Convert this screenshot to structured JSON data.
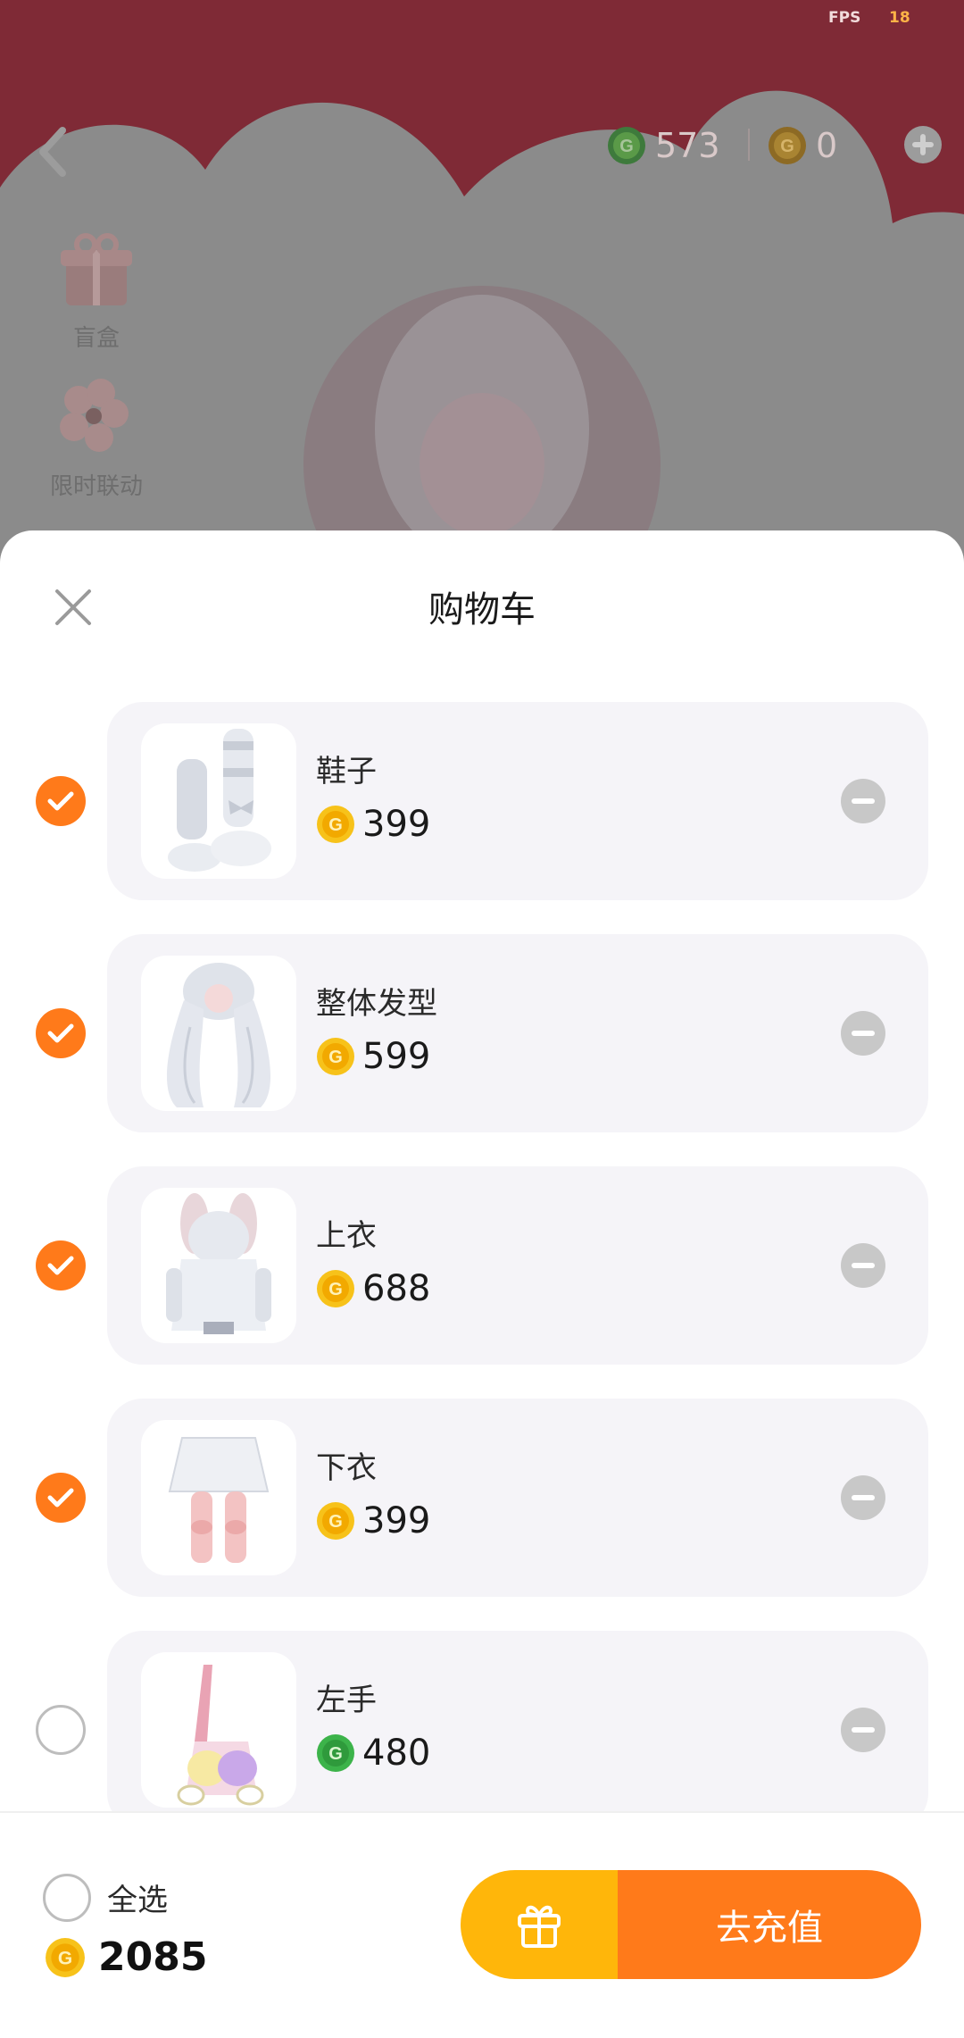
{
  "status": {
    "fps_label": "FPS",
    "fps_value": "18"
  },
  "topbar": {
    "green_coin_balance": "573",
    "gold_coin_balance": "0"
  },
  "side": {
    "gift_label": "盲盒",
    "event_label": "限时联动"
  },
  "cart": {
    "title": "购物车",
    "items": [
      {
        "name": "鞋子",
        "price": "399",
        "currency": "gold",
        "selected": true
      },
      {
        "name": "整体发型",
        "price": "599",
        "currency": "gold",
        "selected": true
      },
      {
        "name": "上衣",
        "price": "688",
        "currency": "gold",
        "selected": true
      },
      {
        "name": "下衣",
        "price": "399",
        "currency": "gold",
        "selected": true
      },
      {
        "name": "左手",
        "price": "480",
        "currency": "green",
        "selected": false
      }
    ]
  },
  "footer": {
    "select_all_label": "全选",
    "total": "2085",
    "topup_label": "去充值"
  },
  "colors": {
    "accent": "#ff7a1a",
    "gift_button": "#ffb60a",
    "gold_coin": "#f7c21a",
    "green_coin": "#3cb34a"
  },
  "icons": [
    "back-icon",
    "plus-icon",
    "close-icon",
    "check-icon",
    "minus-icon",
    "gift-icon",
    "gold-coin-icon",
    "green-coin-icon"
  ]
}
